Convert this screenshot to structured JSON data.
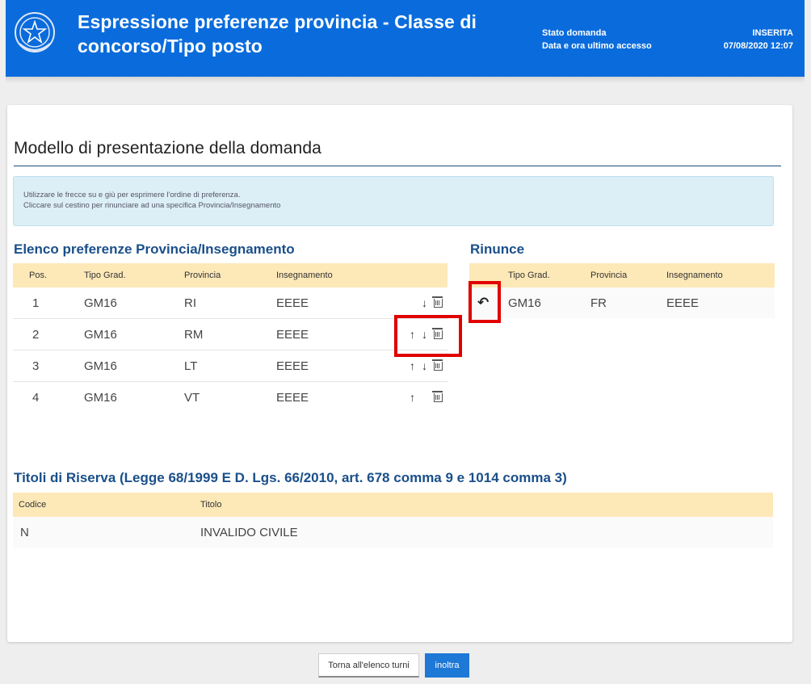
{
  "header": {
    "title": "Espressione preferenze provincia - Classe di concorso/Tipo posto",
    "status_label": "Stato domanda",
    "status_value": "INSERITA",
    "last_access_label": "Data e ora ultimo accesso",
    "last_access_value": "07/08/2020 12:07"
  },
  "page": {
    "title": "Modello di presentazione della domanda",
    "info_line1": "Utilizzare le frecce su e giù per esprimere l'ordine di preferenza.",
    "info_line2": "Cliccare sul cestino per rinunciare ad una specifica Provincia/Insegnamento"
  },
  "preferences": {
    "title": "Elenco preferenze Provincia/Insegnamento",
    "columns": [
      "Pos.",
      "Tipo Grad.",
      "Provincia",
      "Insegnamento"
    ],
    "rows": [
      {
        "pos": "1",
        "tipo": "GM16",
        "provincia": "RI",
        "insegnamento": "EEEE"
      },
      {
        "pos": "2",
        "tipo": "GM16",
        "provincia": "RM",
        "insegnamento": "EEEE"
      },
      {
        "pos": "3",
        "tipo": "GM16",
        "provincia": "LT",
        "insegnamento": "EEEE"
      },
      {
        "pos": "4",
        "tipo": "GM16",
        "provincia": "VT",
        "insegnamento": "EEEE"
      }
    ]
  },
  "rinunce": {
    "title": "Rinunce",
    "columns": [
      "Tipo Grad.",
      "Provincia",
      "Insegnamento"
    ],
    "rows": [
      {
        "tipo": "GM16",
        "provincia": "FR",
        "insegnamento": "EEEE"
      }
    ]
  },
  "riserva": {
    "title": "Titoli di Riserva (Legge 68/1999 E D. Lgs. 66/2010, art. 678 comma 9 e 1014 comma 3)",
    "columns": [
      "Codice",
      "Titolo"
    ],
    "rows": [
      {
        "codice": "N",
        "titolo": "INVALIDO CIVILE"
      }
    ]
  },
  "footer": {
    "back_label": "Torna all'elenco turni",
    "send_label": "inoltra"
  },
  "colors": {
    "header_blue": "#0a6cdc",
    "table_header": "#fde8b8",
    "highlight_red": "#e00000"
  },
  "icons": [
    "emblem-icon",
    "arrow-up-icon",
    "arrow-down-icon",
    "trash-icon",
    "undo-icon"
  ]
}
